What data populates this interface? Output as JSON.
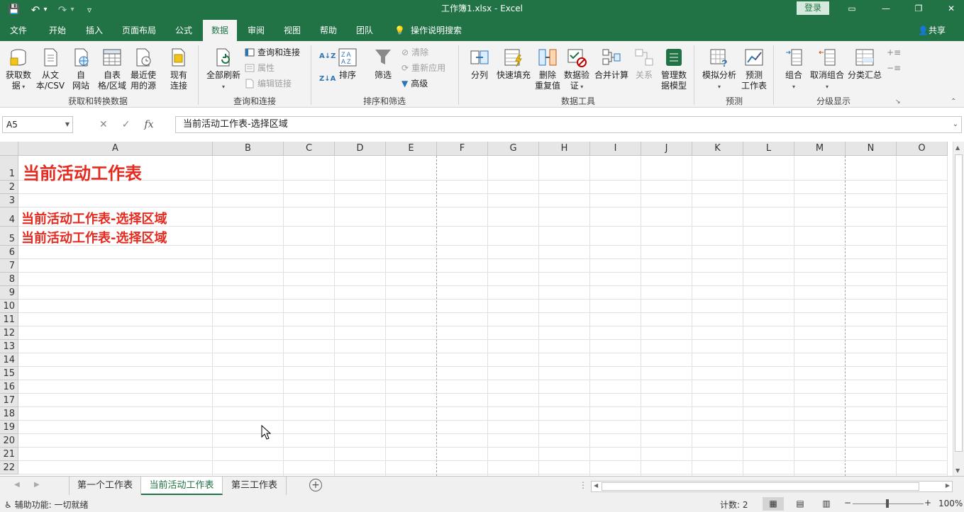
{
  "window": {
    "title": "工作簿1.xlsx  -  Excel",
    "login_label": "登录",
    "controls": {
      "restore_ribbon": "▭",
      "minimize": "—",
      "maximize": "❐",
      "close": "✕"
    }
  },
  "qat": {
    "save": "💾",
    "undo": "↶",
    "undo_dd": "▾",
    "redo": "↷",
    "redo_dd": "▾",
    "customize": "▿"
  },
  "tabs": [
    {
      "label": "文件"
    },
    {
      "label": "开始"
    },
    {
      "label": "插入"
    },
    {
      "label": "页面布局"
    },
    {
      "label": "公式"
    },
    {
      "label": "数据"
    },
    {
      "label": "审阅"
    },
    {
      "label": "视图"
    },
    {
      "label": "帮助"
    },
    {
      "label": "团队"
    }
  ],
  "active_tab": "数据",
  "tellme": "操作说明搜索",
  "share": "共享",
  "ribbon": {
    "get_transform": {
      "group_label": "获取和转换数据",
      "get_data": "获取数\n据",
      "from_csv": "从文\n本/CSV",
      "from_web": "自\n网站",
      "from_table": "自表\n格/区域",
      "recent_sources": "最近使\n用的源",
      "existing_conn": "现有\n连接"
    },
    "queries": {
      "group_label": "查询和连接",
      "refresh_all": "全部刷新",
      "queries_conn": "查询和连接",
      "properties": "属性",
      "edit_links": "编辑链接"
    },
    "sort_filter": {
      "group_label": "排序和筛选",
      "sort": "排序",
      "filter": "筛选",
      "clear": "清除",
      "reapply": "重新应用",
      "advanced": "高级"
    },
    "data_tools": {
      "group_label": "数据工具",
      "text_to_columns": "分列",
      "flash_fill": "快速填充",
      "remove_dup": "删除\n重复值",
      "validation": "数据验\n证",
      "consolidate": "合并计算",
      "relationships": "关系",
      "data_model": "管理数\n据模型"
    },
    "forecast": {
      "group_label": "预测",
      "what_if": "模拟分析",
      "forecast_sheet": "预测\n工作表"
    },
    "outline": {
      "group_label": "分级显示",
      "group": "组合",
      "ungroup": "取消组合",
      "subtotal": "分类汇总"
    }
  },
  "formula_bar": {
    "name_box": "A5",
    "formula": "当前活动工作表-选择区域",
    "fx": "fx"
  },
  "grid": {
    "columns": [
      "A",
      "B",
      "C",
      "D",
      "E",
      "F",
      "G",
      "H",
      "I",
      "J",
      "K",
      "L",
      "M",
      "N",
      "O"
    ],
    "rows": [
      "1",
      "2",
      "3",
      "4",
      "5",
      "6",
      "7",
      "8",
      "9",
      "10",
      "11",
      "12",
      "13",
      "14",
      "15",
      "16",
      "17",
      "18",
      "19",
      "20",
      "21",
      "22"
    ],
    "cells": {
      "A1": "当前活动工作表",
      "A4": "当前活动工作表-选择区域",
      "A5": "当前活动工作表-选择区域"
    },
    "text_color": "#e52b20"
  },
  "sheets": [
    {
      "label": "第一个工作表"
    },
    {
      "label": "当前活动工作表"
    },
    {
      "label": "第三工作表"
    }
  ],
  "active_sheet": "当前活动工作表",
  "statusbar": {
    "accessibility": "辅助功能: 一切就绪",
    "count": "计数: 2",
    "zoom": "100%"
  },
  "colors": {
    "brand": "#217346",
    "ribbon_bg": "#f3f3f3"
  }
}
